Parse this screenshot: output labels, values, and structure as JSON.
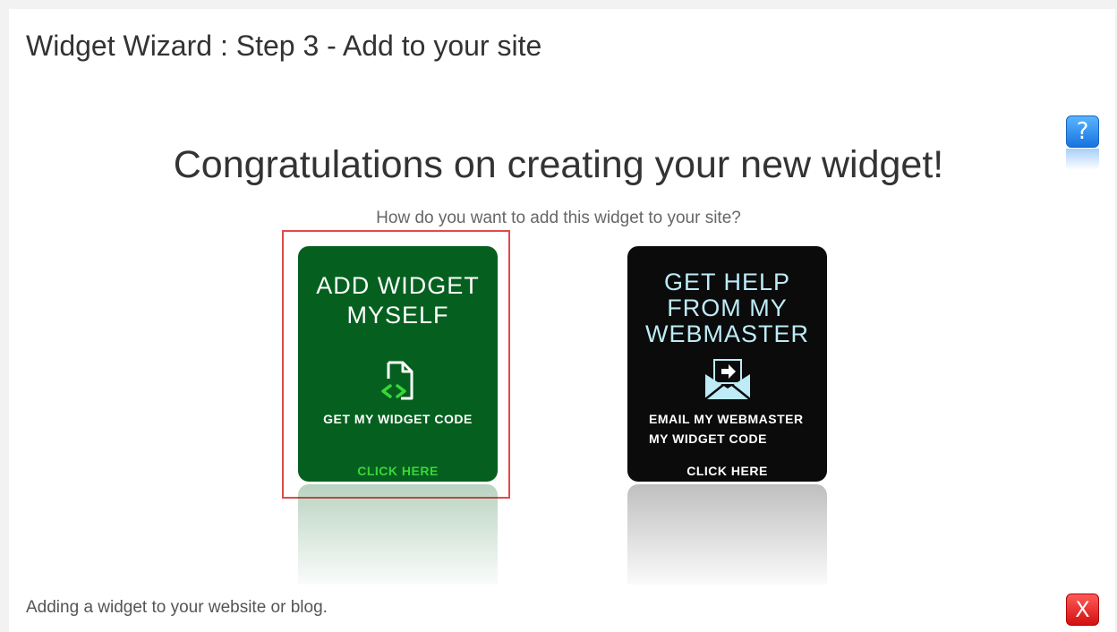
{
  "wizard": {
    "title": "Widget Wizard : Step 3 - Add to your site",
    "help_label": "?",
    "close_label": "X"
  },
  "main": {
    "headline": "Congratulations on creating your new widget!",
    "question": "How do you want to add this widget to your site?"
  },
  "options": [
    {
      "title_line1": "ADD WIDGET",
      "title_line2": "MYSELF",
      "subtitle": "GET MY WIDGET CODE",
      "cta": "CLICK HERE",
      "icon": "code-file-icon",
      "color": "#05601f"
    },
    {
      "title_line1": "GET HELP",
      "title_line2": "FROM MY",
      "title_line3": "WEBMASTER",
      "subtitle_line1": "EMAIL MY WEBMASTER",
      "subtitle_line2": "MY WIDGET CODE",
      "cta": "CLICK HERE",
      "icon": "email-envelope-icon",
      "color": "#0b0b0b"
    }
  ],
  "footer": {
    "text": "Adding a widget to your website or blog."
  },
  "colors": {
    "highlight": "#e14b4b",
    "green_accent": "#39d636",
    "webmaster_title": "#bdebf7"
  }
}
